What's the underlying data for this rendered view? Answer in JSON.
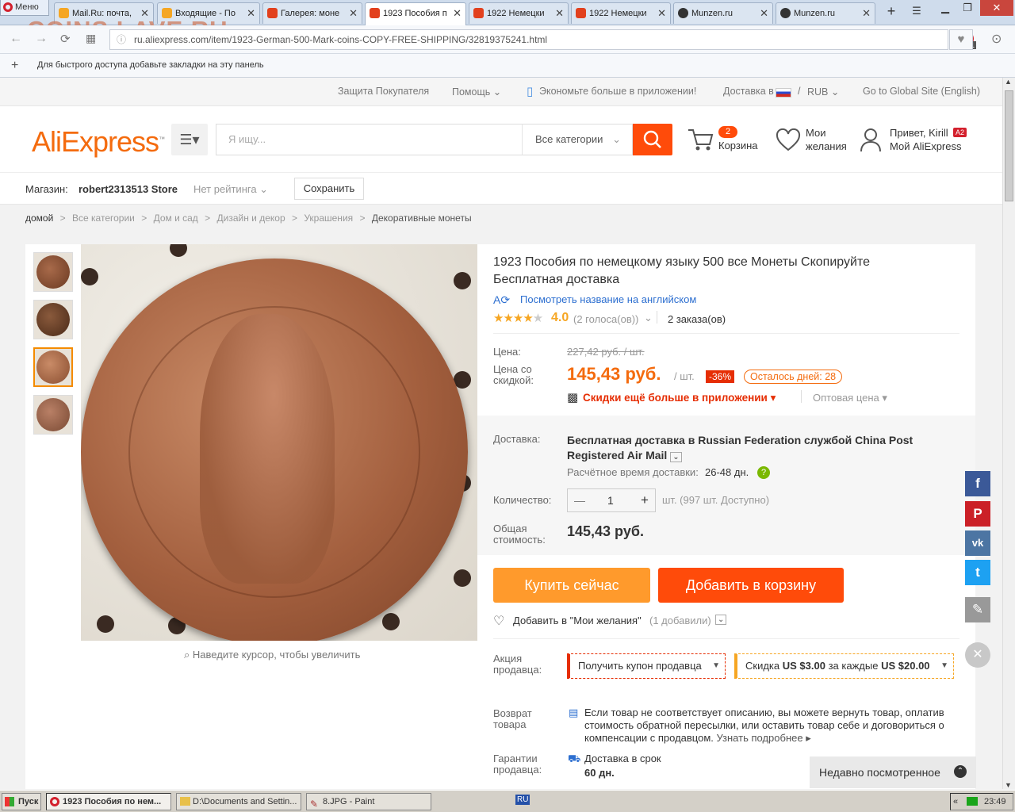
{
  "watermark": "COINS.LAVE.RU",
  "browser": {
    "menu_label": "Меню",
    "tabs": [
      "Mail.Ru: почта,",
      "Входящие - По",
      "Галерея: моне",
      "1923 Пособия п",
      "1922 Немецки",
      "1922 Немецки",
      "Munzen.ru",
      "Munzen.ru"
    ],
    "url": "ru.aliexpress.com/item/1923-German-500-Mark-coins-COPY-FREE-SHIPPING/32819375241.html",
    "bookmarks_hint": "Для быстрого доступа добавьте закладки на эту панель",
    "abp_count": "1"
  },
  "topnav": {
    "protection": "Защита Покупателя",
    "help": "Помощь",
    "app": "Экономьте больше в приложении!",
    "ship_to": "Доставка в",
    "currency": "RUB",
    "global": "Go to Global Site (English)"
  },
  "header": {
    "logo": "AliExpress",
    "search_placeholder": "Я ищу...",
    "category": "Все категории",
    "cart_count": "2",
    "cart_label": "Корзина",
    "wish_line1": "Мои",
    "wish_line2": "желания",
    "greeting": "Привет, Kirill",
    "badge": "A2",
    "my_ali": "Мой AliExpress"
  },
  "store": {
    "label": "Магазин:",
    "name": "robert2313513 Store",
    "rating": "Нет рейтинга",
    "save": "Сохранить"
  },
  "breadcrumbs": [
    "домой",
    ">",
    "Все категории",
    ">",
    "Дом и сад",
    ">",
    "Дизайн и декор",
    ">",
    "Украшения",
    ">",
    "Декоративные монеты"
  ],
  "gallery": {
    "zoom_hint": "Наведите курсор, чтобы увеличить"
  },
  "product": {
    "title": "1923 Пособия по немецкому языку 500 все Монеты Скопируйте Бесплатная доставка",
    "view_english": "Посмотреть название на английском",
    "rating": "4.0",
    "rating_value": 4.0,
    "votes": "(2 голоса(ов))",
    "orders": "2 заказа(ов)",
    "price_label": "Цена:",
    "old_price": "227,42 руб. / шт.",
    "sale_label": "Цена со скидкой:",
    "price": "145,43 руб.",
    "unit": "/ шт.",
    "discount": "-36%",
    "days_left": "Осталось дней: 28",
    "app_discount": "Скидки ещё больше в приложении",
    "wholesale": "Оптовая цена",
    "delivery_label": "Доставка:",
    "delivery_text": "Бесплатная доставка в Russian Federation службой China Post Registered Air Mail",
    "eta_label": "Расчётное время доставки:",
    "eta": "26-48 дн.",
    "qty_label": "Количество:",
    "qty": "1",
    "stock": "шт. (997 шт. Доступно)",
    "total_label": "Общая стоимость:",
    "total": "145,43 руб.",
    "buy_now": "Купить сейчас",
    "add_to_cart": "Добавить в корзину",
    "wishlist": "Добавить в \"Мои желания\"",
    "wishlist_count": "(1 добавили)",
    "promo_label": "Акция продавца:",
    "coupon": "Получить купон продавца",
    "promo_prefix": "Скидка",
    "promo_amount": "US $3.00",
    "promo_mid": "за каждые",
    "promo_threshold": "US $20.00",
    "return_label": "Возврат товара",
    "return_text": "Если товар не соответствует описанию, вы можете вернуть товар, оплатив стоимость обратной пересылки, или оставить товар себе и договориться о компенсации с продавцом.",
    "return_more": "Узнать подробнее",
    "guarantee_label": "Гарантии продавца:",
    "guarantee_text": "Доставка в срок",
    "guarantee_days": "60 дн."
  },
  "recently_viewed": "Недавно посмотренное",
  "social": {
    "colors": {
      "facebook": "#3b5998",
      "pinterest": "#cb2027",
      "vk": "#4c75a3",
      "twitter": "#1da1f2",
      "edit": "#999999"
    }
  },
  "taskbar": {
    "start": "Пуск",
    "items": [
      "1923 Пособия по нем...",
      "D:\\Documents and Settin...",
      "8.JPG - Paint"
    ],
    "lang": "RU",
    "time": "23:49"
  },
  "colors": {
    "accent": "#ff4b0a",
    "buy": "#ff9a2c",
    "price": "#f46b0e"
  }
}
